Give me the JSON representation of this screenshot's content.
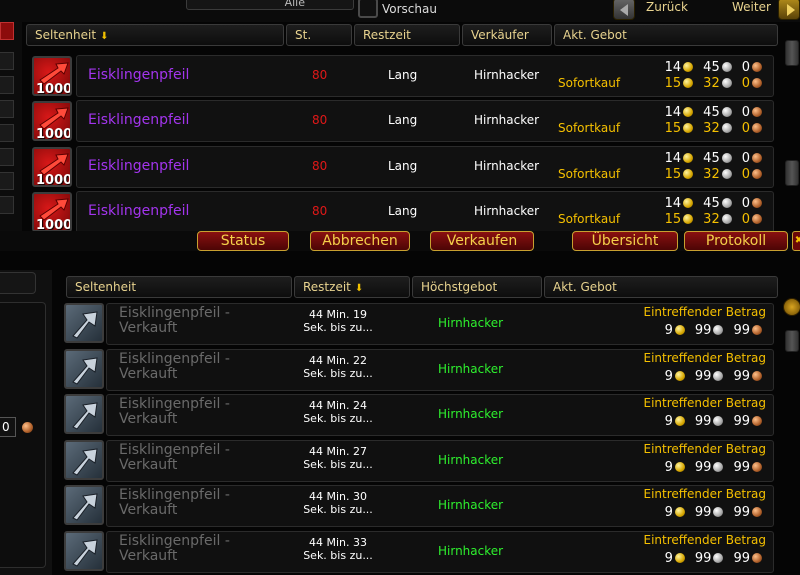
{
  "top": {
    "filter_value": "Alle",
    "preview_label": "Vorschau",
    "back_label": "Zurück",
    "next_label": "Weiter"
  },
  "browse": {
    "headers": {
      "rarity": "Seltenheit",
      "level": "St.",
      "time_left": "Restzeit",
      "seller": "Verkäufer",
      "current_bid": "Akt. Gebot"
    },
    "rows": [
      {
        "count": "1000",
        "name": "Eisklingenpfeil",
        "level": "80",
        "time": "Lang",
        "seller": "Hirnhacker",
        "buyout_label": "Sofortkauf",
        "bid": {
          "gold": "14",
          "silver": "45",
          "copper": "0"
        },
        "buyout": {
          "gold": "15",
          "silver": "32",
          "copper": "0"
        }
      },
      {
        "count": "1000",
        "name": "Eisklingenpfeil",
        "level": "80",
        "time": "Lang",
        "seller": "Hirnhacker",
        "buyout_label": "Sofortkauf",
        "bid": {
          "gold": "14",
          "silver": "45",
          "copper": "0"
        },
        "buyout": {
          "gold": "15",
          "silver": "32",
          "copper": "0"
        }
      },
      {
        "count": "1000",
        "name": "Eisklingenpfeil",
        "level": "80",
        "time": "Lang",
        "seller": "Hirnhacker",
        "buyout_label": "Sofortkauf",
        "bid": {
          "gold": "14",
          "silver": "45",
          "copper": "0"
        },
        "buyout": {
          "gold": "15",
          "silver": "32",
          "copper": "0"
        }
      },
      {
        "count": "1000",
        "name": "Eisklingenpfeil",
        "level": "80",
        "time": "Lang",
        "seller": "Hirnhacker",
        "buyout_label": "Sofortkauf",
        "bid": {
          "gold": "14",
          "silver": "45",
          "copper": "0"
        },
        "buyout": {
          "gold": "15",
          "silver": "32",
          "copper": "0"
        }
      }
    ]
  },
  "tabs": {
    "status": "Status",
    "cancel": "Abbrechen",
    "sell": "Verkaufen",
    "overview": "Übersicht",
    "log": "Protokoll"
  },
  "sold": {
    "headers": {
      "rarity": "Seltenheit",
      "time_left": "Restzeit",
      "highest_bid": "Höchstgebot",
      "current_bid": "Akt. Gebot"
    },
    "bottom_left_value": "0",
    "rows": [
      {
        "name_line1": "Eisklingenpfeil -",
        "name_line2": "Verkauft",
        "time_line1": "44 Min. 19",
        "time_line2": "Sek. bis zu...",
        "buyer": "Hirnhacker",
        "incoming_label": "Eintreffender Betrag",
        "gold": "9",
        "silver": "99",
        "copper": "99"
      },
      {
        "name_line1": "Eisklingenpfeil -",
        "name_line2": "Verkauft",
        "time_line1": "44 Min. 22",
        "time_line2": "Sek. bis zu...",
        "buyer": "Hirnhacker",
        "incoming_label": "Eintreffender Betrag",
        "gold": "9",
        "silver": "99",
        "copper": "99"
      },
      {
        "name_line1": "Eisklingenpfeil -",
        "name_line2": "Verkauft",
        "time_line1": "44 Min. 24",
        "time_line2": "Sek. bis zu...",
        "buyer": "Hirnhacker",
        "incoming_label": "Eintreffender Betrag",
        "gold": "9",
        "silver": "99",
        "copper": "99"
      },
      {
        "name_line1": "Eisklingenpfeil -",
        "name_line2": "Verkauft",
        "time_line1": "44 Min. 27",
        "time_line2": "Sek. bis zu...",
        "buyer": "Hirnhacker",
        "incoming_label": "Eintreffender Betrag",
        "gold": "9",
        "silver": "99",
        "copper": "99"
      },
      {
        "name_line1": "Eisklingenpfeil -",
        "name_line2": "Verkauft",
        "time_line1": "44 Min. 30",
        "time_line2": "Sek. bis zu...",
        "buyer": "Hirnhacker",
        "incoming_label": "Eintreffender Betrag",
        "gold": "9",
        "silver": "99",
        "copper": "99"
      },
      {
        "name_line1": "Eisklingenpfeil -",
        "name_line2": "Verkauft",
        "time_line1": "44 Min. 33",
        "time_line2": "Sek. bis zu...",
        "buyer": "Hirnhacker",
        "incoming_label": "Eintreffender Betrag",
        "gold": "9",
        "silver": "99",
        "copper": "99"
      }
    ]
  }
}
